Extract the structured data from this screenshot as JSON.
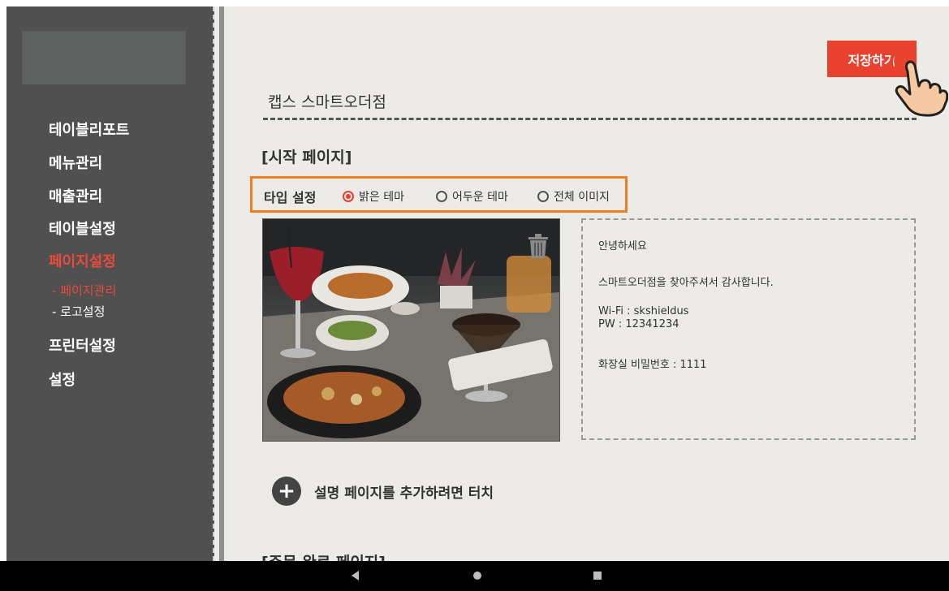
{
  "sidebar": {
    "items": [
      {
        "label": "테이블리포트"
      },
      {
        "label": "메뉴관리"
      },
      {
        "label": "매출관리"
      },
      {
        "label": "테이블설정"
      },
      {
        "label": "페이지설정"
      },
      {
        "label": "- 페이지관리"
      },
      {
        "label": "- 로고설정"
      },
      {
        "label": "프린터설정"
      },
      {
        "label": "설정"
      }
    ]
  },
  "toolbar": {
    "save_label": "저장하기"
  },
  "store": {
    "name": "캡스 스마트오더점"
  },
  "start_page": {
    "title": "[시작 페이지]",
    "type_label": "타입 설정",
    "options": [
      "밝은 테마",
      "어두운 테마",
      "전체 이미지"
    ],
    "selected": "밝은 테마",
    "message_lines": [
      "안녕하세요",
      "스마트오더점을 찾아주셔서 감사합니다.",
      "Wi-Fi : skshieldus",
      "PW : 12341234",
      "화장실 비밀번호 : 1111"
    ],
    "add_page_label": "설명 페이지를 추가하려면 터치"
  },
  "next_section": {
    "title": "[주문 완료 페이지]"
  },
  "colors": {
    "accent": "#e8422e",
    "highlight": "#ef7f22",
    "sidebar": "#505050",
    "background": "#ecebe8"
  },
  "icons": {
    "hand": "hand-tap-icon",
    "trash": "trash-icon",
    "plus": "plus-circle-icon"
  }
}
